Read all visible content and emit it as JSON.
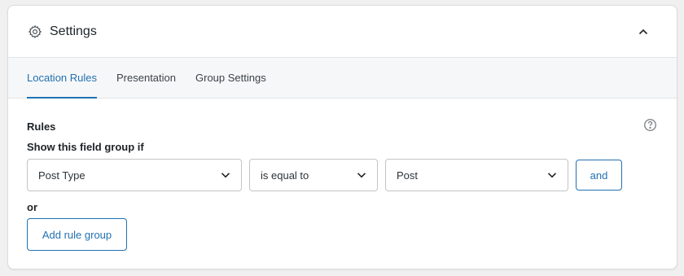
{
  "panel": {
    "title": "Settings",
    "icons": {
      "settings": "gear-icon",
      "collapse": "chevron-up-icon",
      "help": "question-circle-icon"
    }
  },
  "tabs": [
    {
      "label": "Location Rules",
      "active": true
    },
    {
      "label": "Presentation",
      "active": false
    },
    {
      "label": "Group Settings",
      "active": false
    }
  ],
  "rules": {
    "label": "Rules",
    "condition_label": "Show this field group if",
    "param": {
      "value": "Post Type"
    },
    "operator": {
      "value": "is equal to"
    },
    "value": {
      "value": "Post"
    },
    "and_label": "and",
    "or_label": "or",
    "add_group_label": "Add rule group"
  },
  "colors": {
    "accent": "#2271b1",
    "text": "#1d2327",
    "border": "#c3c4c7"
  }
}
